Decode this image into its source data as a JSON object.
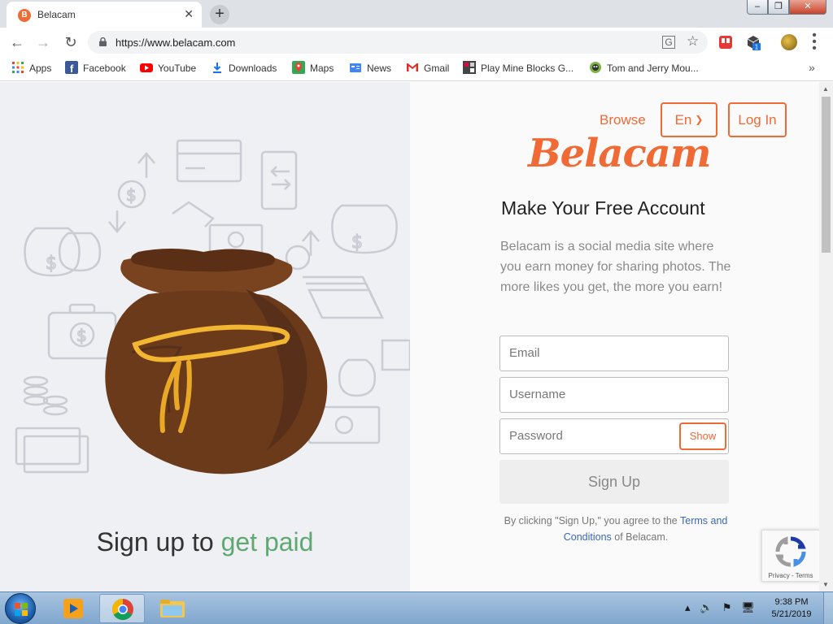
{
  "browser": {
    "tab_title": "Belacam",
    "tab_favicon_letter": "B",
    "url": "https://www.belacam.com",
    "bookmarks": [
      {
        "label": "Apps",
        "icon": "apps-grid-icon"
      },
      {
        "label": "Facebook",
        "icon": "facebook-icon"
      },
      {
        "label": "YouTube",
        "icon": "youtube-icon"
      },
      {
        "label": "Downloads",
        "icon": "download-icon"
      },
      {
        "label": "Maps",
        "icon": "maps-icon"
      },
      {
        "label": "News",
        "icon": "news-icon"
      },
      {
        "label": "Gmail",
        "icon": "gmail-icon"
      },
      {
        "label": "Play Mine Blocks G...",
        "icon": "game-icon"
      },
      {
        "label": "Tom and Jerry Mou...",
        "icon": "game-icon"
      }
    ],
    "bookmarks_more": "»",
    "ext_badge": "1"
  },
  "page": {
    "promo": {
      "text_prefix": "Sign up to ",
      "text_highlight": "get paid"
    },
    "nav": {
      "browse": "Browse",
      "language": "En",
      "login": "Log In"
    },
    "brand": "Belacam",
    "headline": "Make Your Free Account",
    "description": "Belacam is a social media site where you earn money for sharing photos. The more likes you get, the more you earn!",
    "form": {
      "email_placeholder": "Email",
      "username_placeholder": "Username",
      "password_placeholder": "Password",
      "show_label": "Show",
      "signup_label": "Sign Up"
    },
    "terms": {
      "prefix": "By clicking \"Sign Up,\" you agree to the ",
      "link": "Terms and Conditions",
      "suffix": " of Belacam."
    },
    "recaptcha_label": "Privacy - Terms"
  },
  "taskbar": {
    "time": "9:38 PM",
    "date": "5/21/2019"
  },
  "colors": {
    "accent": "#f06a35",
    "promo_green": "#5fa872",
    "link_blue": "#3a68b4"
  }
}
